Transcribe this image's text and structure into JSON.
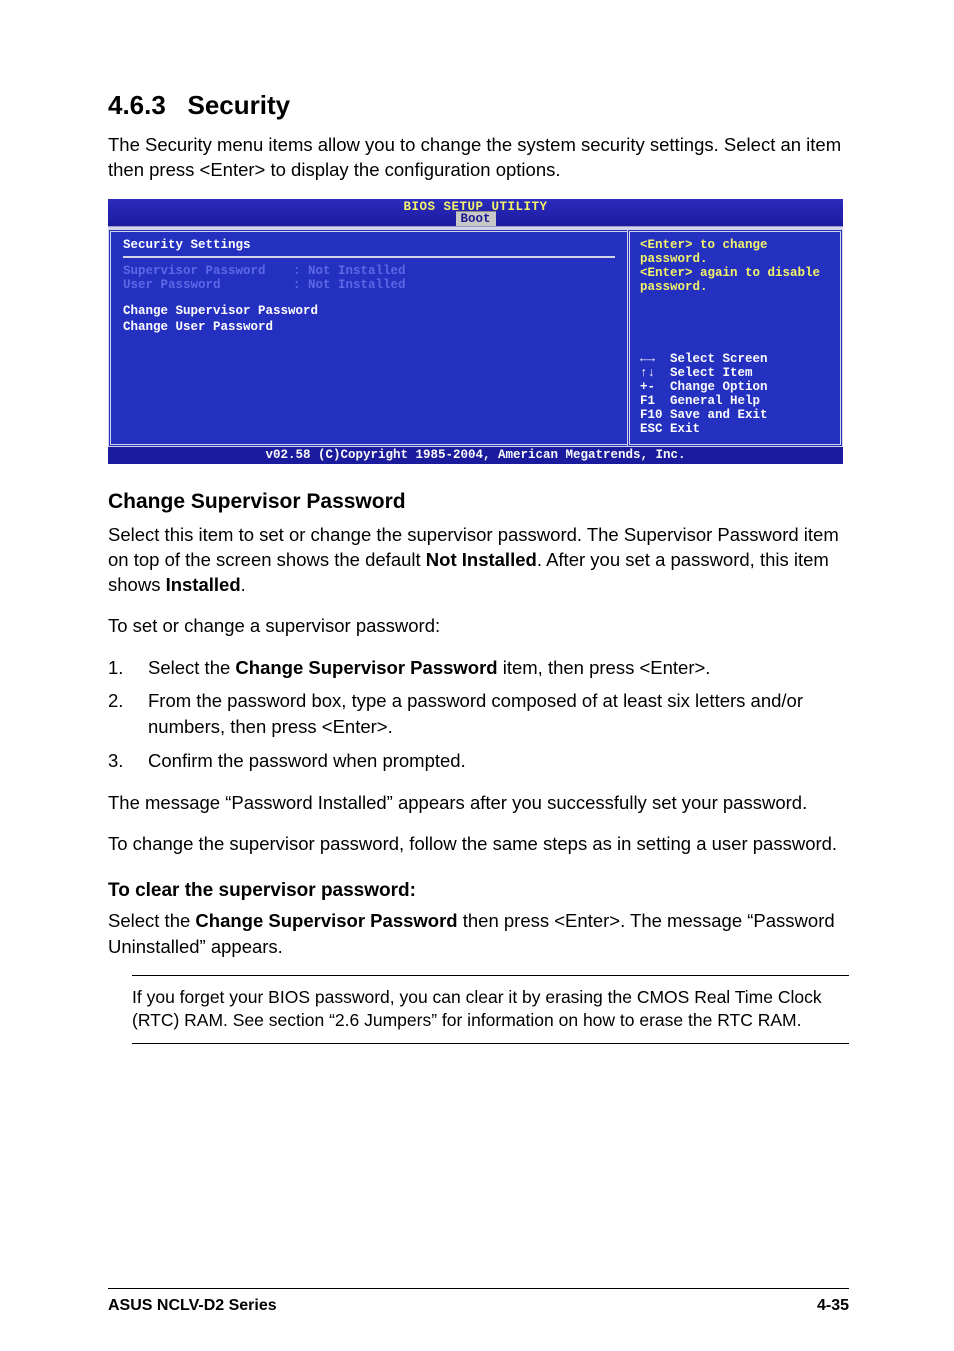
{
  "section": {
    "number": "4.6.3",
    "title": "Security"
  },
  "intro": "The Security menu items allow you to change the system security settings. Select an item then press <Enter> to display the configuration options.",
  "bios": {
    "utility_title": "BIOS SETUP UTILITY",
    "active_tab": "Boot",
    "panel_title": "Security Settings",
    "fields": [
      {
        "label": "Supervisor Password",
        "value": ": Not Installed"
      },
      {
        "label": "User Password",
        "value": ": Not Installed"
      }
    ],
    "menu_items": [
      "Change Supervisor Password",
      "Change User Password"
    ],
    "help_top": "<Enter> to change password.\n<Enter> again to disable password.",
    "help_bottom": "←→  Select Screen\n↑↓  Select Item\n+-  Change Option\nF1  General Help\nF10 Save and Exit\nESC Exit",
    "copyright": "v02.58 (C)Copyright 1985-2004, American Megatrends, Inc."
  },
  "sub1": {
    "heading": "Change Supervisor Password",
    "p1a": "Select this item to set or change the supervisor password. The Supervisor Password item on top of the screen shows the default ",
    "p1b": "Not Installed",
    "p1c": ". After you set a password, this item shows ",
    "p1d": "Installed",
    "p1e": ".",
    "p2": "To set or change a supervisor password:",
    "steps": [
      {
        "num": "1.",
        "pre": "Select the ",
        "bold": "Change Supervisor Password",
        "post": " item, then press <Enter>."
      },
      {
        "num": "2.",
        "pre": "From the password box, type a password composed of at least six letters and/or numbers, then press <Enter>.",
        "bold": "",
        "post": ""
      },
      {
        "num": "3.",
        "pre": "Confirm the password when prompted.",
        "bold": "",
        "post": ""
      }
    ],
    "p3": "The message “Password Installed” appears after you successfully set your password.",
    "p4": "To change the supervisor password, follow the same steps as in setting a user password."
  },
  "sub2": {
    "heading": "To clear the supervisor password:",
    "p1a": "Select the ",
    "p1b": "Change Supervisor Password",
    "p1c": " then press <Enter>. The message “Password Uninstalled” appears."
  },
  "note": "If you forget your BIOS password, you can clear it by erasing the CMOS Real Time Clock (RTC) RAM. See section “2.6  Jumpers” for information on how to erase the RTC RAM.",
  "footer": {
    "left": "ASUS NCLV-D2 Series",
    "right": "4-35"
  }
}
